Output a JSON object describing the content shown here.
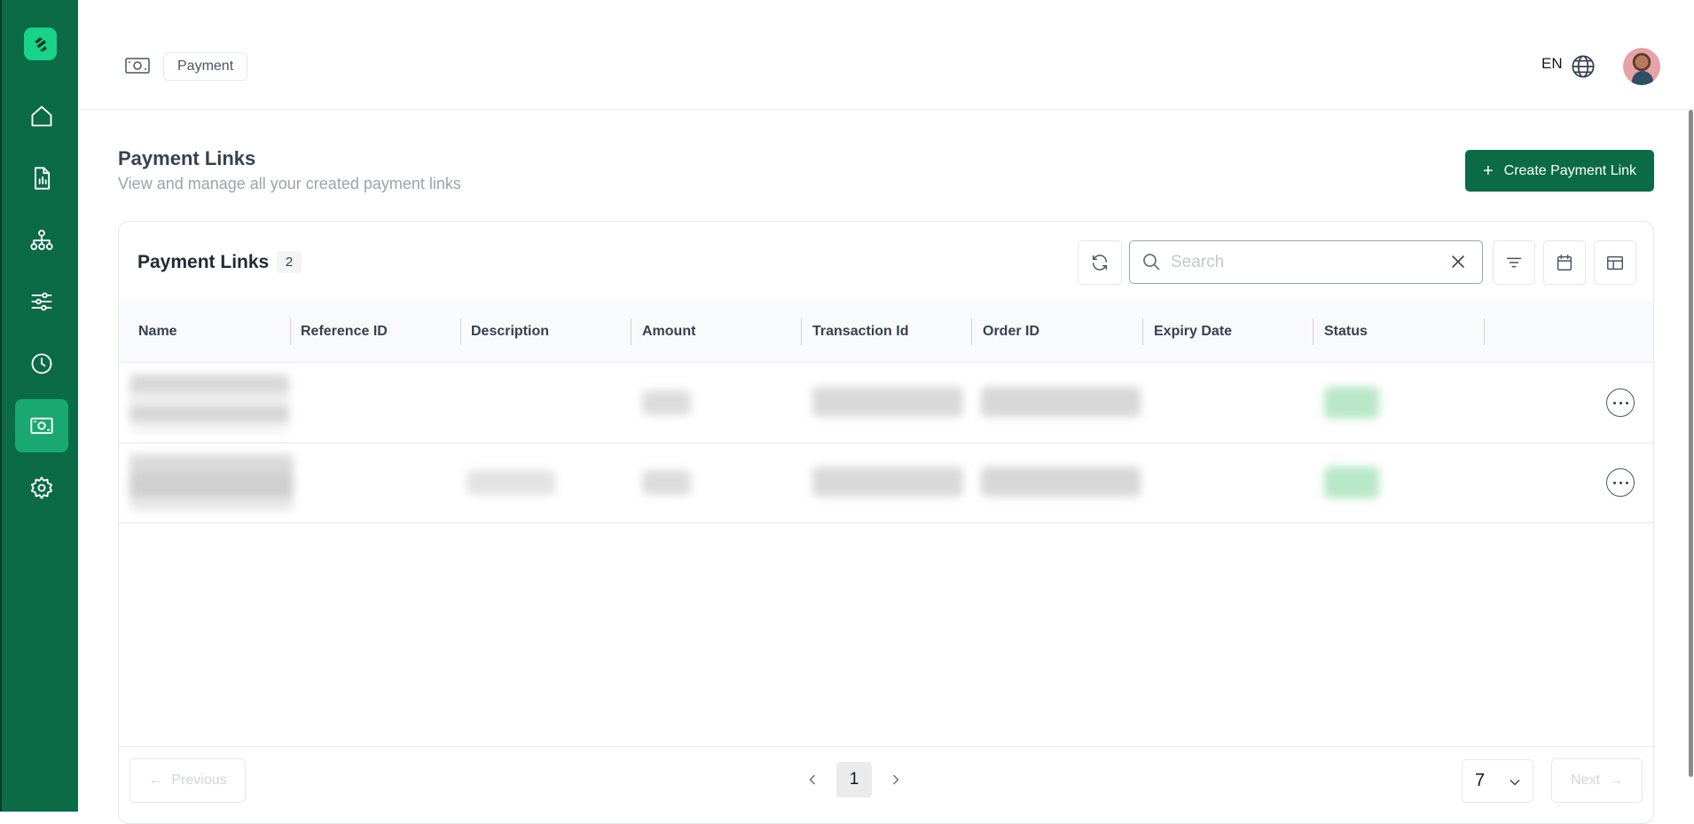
{
  "header": {
    "breadcrumb": "Payment",
    "language": "EN"
  },
  "page": {
    "title": "Payment Links",
    "subtitle": "View and manage all your created payment links",
    "create_button": "Create Payment Link"
  },
  "table_card": {
    "title": "Payment Links",
    "count": "2",
    "search_placeholder": "Search",
    "columns": [
      "Name",
      "Reference ID",
      "Description",
      "Amount",
      "Transaction Id",
      "Order ID",
      "Expiry Date",
      "Status"
    ]
  },
  "pagination": {
    "previous_label": "Previous",
    "next_label": "Next",
    "current_page": "1",
    "page_size": "7"
  },
  "colors": {
    "sidebar": "#0b6b47",
    "accent": "#19d38a",
    "active_nav": "#19a871"
  },
  "icons": [
    "home-icon",
    "report-icon",
    "hierarchy-icon",
    "sliders-icon",
    "clock-icon",
    "payment-icon",
    "settings-icon"
  ]
}
